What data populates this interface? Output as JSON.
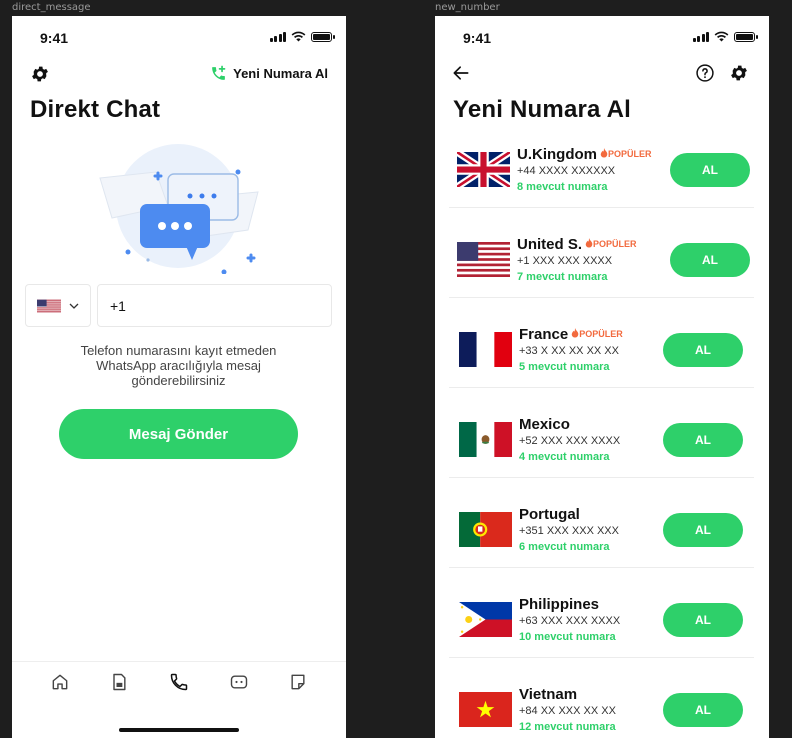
{
  "frames": {
    "left_label": "direct_message",
    "right_label": "new_number"
  },
  "status": {
    "time": "9:41"
  },
  "direct_chat": {
    "get_number_label": "Yeni Numara Al",
    "title": "Direkt Chat",
    "country_flag": "us-flag-icon",
    "phone_value": "+1",
    "description": "Telefon numarasını kayıt etmeden WhatsApp aracılığıyla mesaj gönderebilirsiniz",
    "send_label": "Mesaj Gönder",
    "accent": "#2ed06a",
    "tabs": [
      "home-icon",
      "sim-card-icon",
      "phone-icon",
      "chat-bot-icon",
      "note-icon"
    ]
  },
  "new_number": {
    "title": "Yeni Numara Al",
    "popular_label": "POPÜLER",
    "buy_label": "AL",
    "countries": [
      {
        "name": "U.Kingdom",
        "format": "+44 XXXX XXXXXX",
        "available": "8 mevcut numara",
        "popular": true
      },
      {
        "name": "United S.",
        "format": "+1 XXX XXX XXXX",
        "available": "7 mevcut numara",
        "popular": true
      },
      {
        "name": "France",
        "format": "+33 X XX XX XX XX",
        "available": "5 mevcut numara",
        "popular": true
      },
      {
        "name": "Mexico",
        "format": "+52 XXX XXX XXXX",
        "available": "4 mevcut numara",
        "popular": false
      },
      {
        "name": "Portugal",
        "format": "+351 XXX XXX XXX",
        "available": "6 mevcut numara",
        "popular": false
      },
      {
        "name": "Philippines",
        "format": "+63 XXX XXX XXXX",
        "available": "10 mevcut numara",
        "popular": false
      },
      {
        "name": "Vietnam",
        "format": "+84 XX XXX XX XX",
        "available": "12 mevcut numara",
        "popular": false
      }
    ]
  }
}
